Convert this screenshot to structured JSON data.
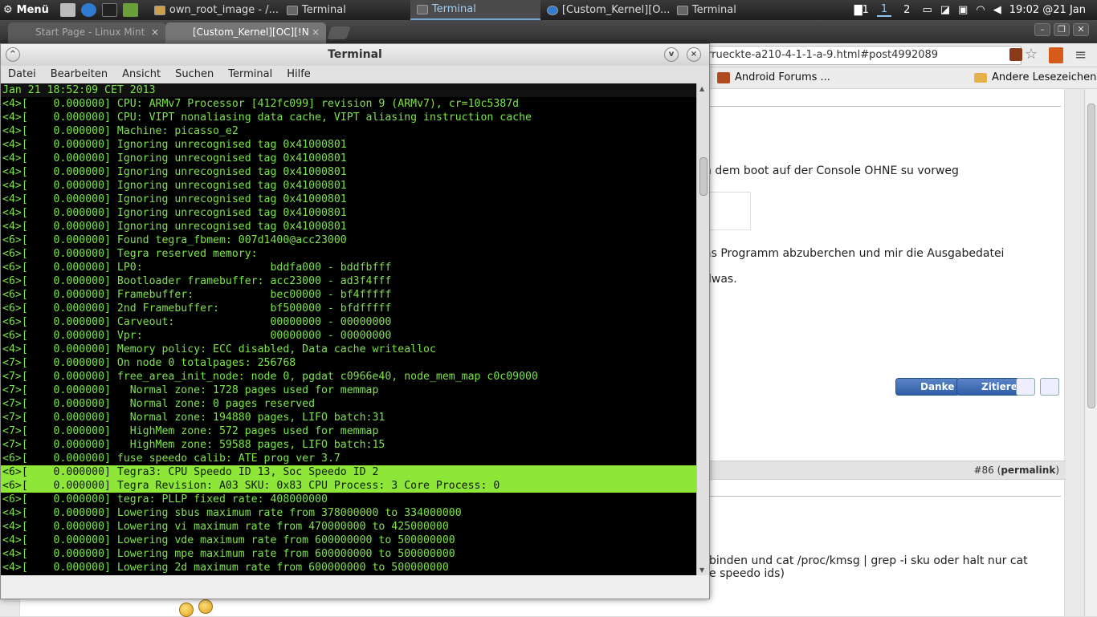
{
  "panel": {
    "menu_label": "Menü",
    "tasks": [
      "own_root_image - /...",
      "Terminal",
      "Terminal",
      "[Custom_Kernel][O...",
      "Terminal"
    ],
    "ws1": "1",
    "ws2": "2",
    "msg_count": "1",
    "clock": "19:02 @21 Jan"
  },
  "browser": {
    "tabs": [
      "Start Page - Linux Mint",
      "[Custom_Kernel][OC][!N"
    ],
    "url": "rrueckte-a210-4-1-1-a-9.html#post4992089",
    "bookmarks": [
      "Android Forums ...",
      "Andere Lesezeichen"
    ],
    "page_texts": [
      "h dem boot auf der Console OHNE su vorweg",
      "as Programm abzuberchen und mir die Ausgabedatei",
      "dwas.",
      "binden und cat /proc/kmsg | grep -i sku oder halt nur cat",
      "e speedo ids)"
    ],
    "buttons": {
      "danke": "Danke",
      "zitieren": "Zitieren"
    },
    "post_num": "#86",
    "permalink": "permalink"
  },
  "terminal": {
    "title": "Terminal",
    "menu": [
      "Datei",
      "Bearbeiten",
      "Ansicht",
      "Suchen",
      "Terminal",
      "Hilfe"
    ],
    "lines": [
      "Jan 21 18:52:09 CET 2013",
      "<4>[    0.000000] CPU: ARMv7 Processor [412fc099] revision 9 (ARMv7), cr=10c5387d",
      "<4>[    0.000000] CPU: VIPT nonaliasing data cache, VIPT aliasing instruction cache",
      "<4>[    0.000000] Machine: picasso_e2",
      "<4>[    0.000000] Ignoring unrecognised tag 0x41000801",
      "<4>[    0.000000] Ignoring unrecognised tag 0x41000801",
      "<4>[    0.000000] Ignoring unrecognised tag 0x41000801",
      "<4>[    0.000000] Ignoring unrecognised tag 0x41000801",
      "<4>[    0.000000] Ignoring unrecognised tag 0x41000801",
      "<4>[    0.000000] Ignoring unrecognised tag 0x41000801",
      "<4>[    0.000000] Ignoring unrecognised tag 0x41000801",
      "<6>[    0.000000] Found tegra_fbmem: 007d1400@acc23000",
      "<6>[    0.000000] Tegra reserved memory:",
      "<6>[    0.000000] LP0:                    bddfa000 - bddfbfff",
      "<6>[    0.000000] Bootloader framebuffer: acc23000 - ad3f4fff",
      "<6>[    0.000000] Framebuffer:            bec00000 - bf4fffff",
      "<6>[    0.000000] 2nd Framebuffer:        bf500000 - bfdfffff",
      "<6>[    0.000000] Carveout:               00000000 - 00000000",
      "<6>[    0.000000] Vpr:                    00000000 - 00000000",
      "<4>[    0.000000] Memory policy: ECC disabled, Data cache writealloc",
      "<7>[    0.000000] On node 0 totalpages: 256768",
      "<7>[    0.000000] free_area_init_node: node 0, pgdat c0966e40, node_mem_map c0c09000",
      "<7>[    0.000000]   Normal zone: 1728 pages used for memmap",
      "<7>[    0.000000]   Normal zone: 0 pages reserved",
      "<7>[    0.000000]   Normal zone: 194880 pages, LIFO batch:31",
      "<7>[    0.000000]   HighMem zone: 572 pages used for memmap",
      "<7>[    0.000000]   HighMem zone: 59588 pages, LIFO batch:15",
      "<6>[    0.000000] fuse speedo calib: ATE prog ver 3.7",
      "<6>[    0.000000] Tegra3: CPU Speedo ID 13, Soc Speedo ID 2",
      "<6>[    0.000000] Tegra Revision: A03 SKU: 0x83 CPU Process: 3 Core Process: 0",
      "<6>[    0.000000] tegra: PLLP fixed rate: 408000000",
      "<4>[    0.000000] Lowering sbus maximum rate from 378000000 to 334000000",
      "<4>[    0.000000] Lowering vi maximum rate from 470000000 to 425000000",
      "<4>[    0.000000] Lowering vde maximum rate from 600000000 to 500000000",
      "<4>[    0.000000] Lowering mpe maximum rate from 600000000 to 500000000",
      "<4>[    0.000000] Lowering 2d maximum rate from 600000000 to 500000000"
    ]
  }
}
